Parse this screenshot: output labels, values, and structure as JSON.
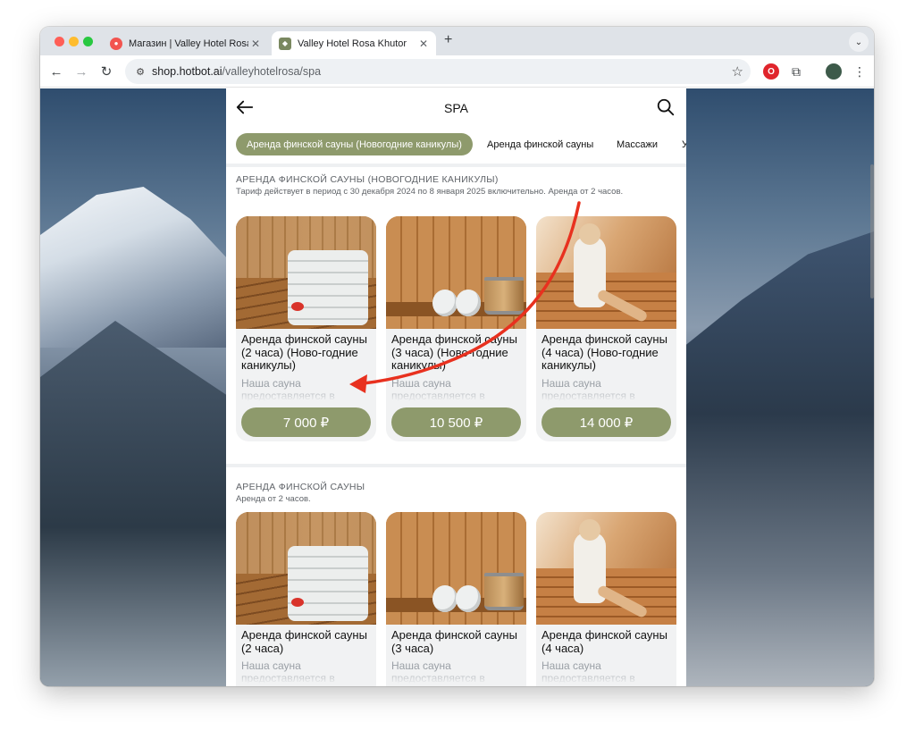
{
  "browser": {
    "tabs": [
      {
        "title": "Магазин | Valley Hotel Rosa Khutor",
        "active": false
      },
      {
        "title": "Valley Hotel Rosa Khutor",
        "active": true
      }
    ],
    "url_host": "shop.hotbot.ai",
    "url_path": "/valleyhotelrosa/spa"
  },
  "header": {
    "title": "SPA"
  },
  "chips": [
    {
      "label": "Аренда финской сауны (Новогодние каникулы)",
      "active": true
    },
    {
      "label": "Аренда финской сауны",
      "active": false
    },
    {
      "label": "Массажи",
      "active": false
    },
    {
      "label": "У",
      "active": false
    }
  ],
  "sections": [
    {
      "title": "Аренда финской сауны (Новогодние каникулы)",
      "description": "Тариф действует в период с 30 декабря 2024 по 8 января 2025 включительно. Аренда от 2 часов.",
      "cards": [
        {
          "name": "Аренда финской сауны (2 часа) (Ново-годние каникулы)",
          "desc": "Наша сауна предоставляется в",
          "price": "7 000 ₽",
          "image": "towels"
        },
        {
          "name": "Аренда финской сауны (3 часа) (Ново-годние каникулы)",
          "desc": "Наша сауна предоставляется в",
          "price": "10 500 ₽",
          "image": "rolls"
        },
        {
          "name": "Аренда финской сауны (4 часа) (Ново-годние каникулы)",
          "desc": "Наша сауна предоставляется в",
          "price": "14 000 ₽",
          "image": "woman"
        }
      ]
    },
    {
      "title": "Аренда финской сауны",
      "description": "Аренда от 2 часов.",
      "cards": [
        {
          "name": "Аренда финской сауны (2 часа)",
          "desc": "Наша сауна предоставляется в",
          "image": "towels"
        },
        {
          "name": "Аренда финской сауны (3 часа)",
          "desc": "Наша сауна предоставляется в",
          "image": "rolls"
        },
        {
          "name": "Аренда финской сауны (4 часа)",
          "desc": "Наша сауна предоставляется в",
          "image": "woman"
        }
      ]
    }
  ],
  "colors": {
    "accent": "#8e9a6c",
    "annotation_arrow": "#e8311f"
  }
}
